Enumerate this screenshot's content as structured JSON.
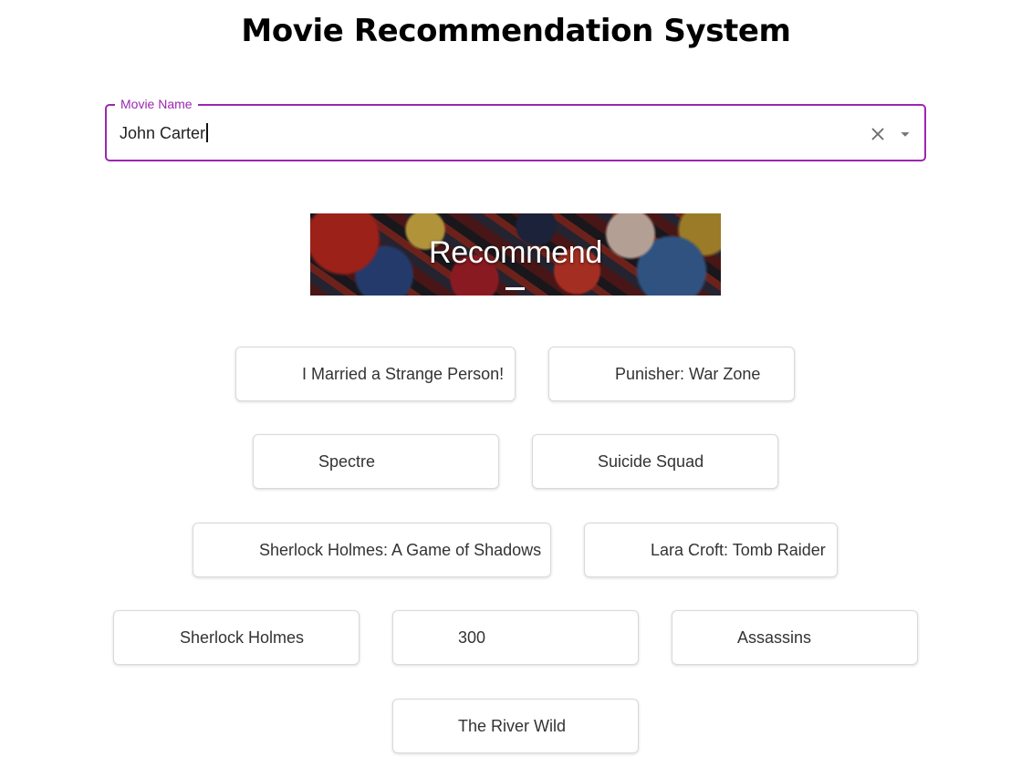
{
  "header": {
    "title": "Movie Recommendation System"
  },
  "search": {
    "label": "Movie Name",
    "value": "John Carter"
  },
  "banner": {
    "label": "Recommend"
  },
  "recommendations": [
    "I Married a Strange Person!",
    "Punisher: War Zone",
    "Spectre",
    "Suicide Squad",
    "Sherlock Holmes: A Game of Shadows",
    "Lara Croft: Tomb Raider",
    "Sherlock Holmes",
    "300",
    "Assassins",
    "The River Wild"
  ],
  "colors": {
    "accent": "#9c27b0",
    "banner_text": "#ffffff"
  }
}
